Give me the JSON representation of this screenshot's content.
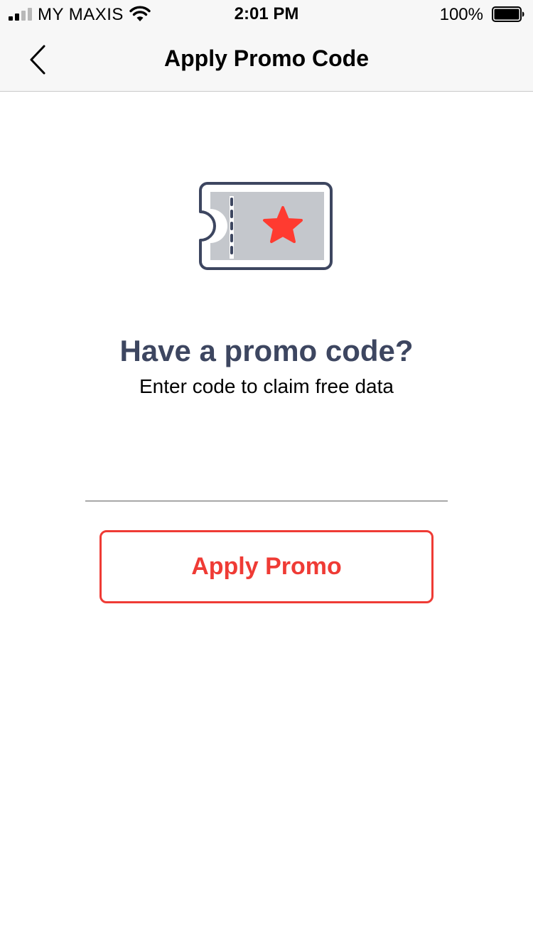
{
  "status_bar": {
    "carrier": "MY MAXIS",
    "time": "2:01 PM",
    "battery_percent": "100%",
    "signal_bars_active": 2,
    "signal_bars_total": 4
  },
  "nav": {
    "title": "Apply Promo Code",
    "back_icon": "chevron-left-icon"
  },
  "hero": {
    "icon": "ticket-star-icon",
    "headline": "Have a promo code?",
    "subline": "Enter code to claim free data"
  },
  "promo_input": {
    "value": "",
    "placeholder": ""
  },
  "apply_button": {
    "label": "Apply Promo"
  },
  "colors": {
    "accent": "#ef3b35",
    "headline": "#3d4660",
    "ticket_fill": "#c4c7cc",
    "ticket_outline": "#3d4660",
    "star": "#ff3b30"
  }
}
